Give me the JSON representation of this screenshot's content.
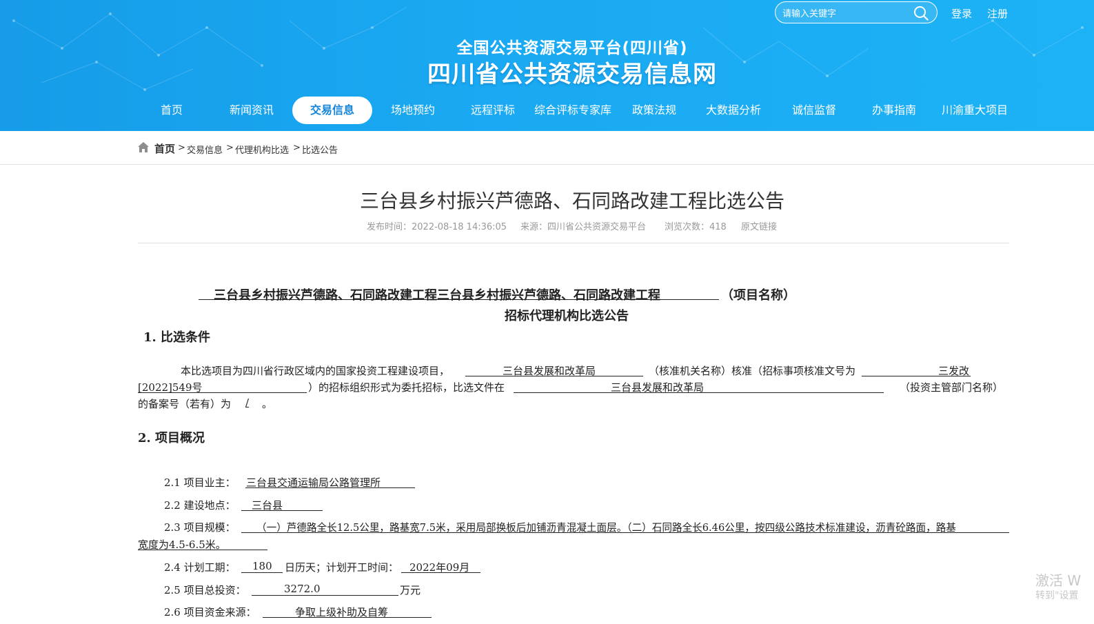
{
  "header": {
    "search_placeholder": "请输入关键字",
    "login": "登录",
    "register": "注册",
    "sub_title": "全国公共资源交易平台(四川省)",
    "main_title": "四川省公共资源交易信息网",
    "nav": [
      "首页",
      "新闻资讯",
      "交易信息",
      "场地预约",
      "远程评标",
      "综合评标专家库",
      "政策法规",
      "大数据分析",
      "诚信监督",
      "办事指南",
      "川渝重大项目"
    ],
    "active_nav": "交易信息"
  },
  "breadcrumb": {
    "home": "首页",
    "items": [
      "交易信息",
      "代理机构比选",
      "比选公告"
    ],
    "separator": ">"
  },
  "article": {
    "title": "三台县乡村振兴芦德路、石同路改建工程比选公告",
    "meta": {
      "publish_time": "发布时间：2022-08-18 14:36:05",
      "source": "来源：四川省公共资源交易平台",
      "views": "浏览次数：418",
      "original_link": "原文链接"
    }
  },
  "doc": {
    "heading_name": "三台县乡村振兴芦德路、石同路改建工程三台县乡村振兴芦德路、石同路改建工程",
    "heading_suffix": "（项目名称）",
    "heading_line2": "招标代理机构比选公告",
    "sec1_title": "1.  比选条件",
    "p1_a": "本比选项目为四川省行政区域内的国家投资工程建设项目，",
    "p1_agency": "三台县发展和改革局",
    "p1_b": "（核准机关名称）核准（招标事项核准文号为",
    "p1_docno_a": "三发改",
    "p1_docno_b": "[2022]549号",
    "p1_c": "）的招标组织形式为委托招标，比选文件在",
    "p1_dept": "三台县发展和改革局",
    "p1_d": "（投资主管部门名称）",
    "p1_e": "的备案号（若有）为",
    "p1_record": "/",
    "p1_end": "。",
    "sec2_title": "2.  项目概况",
    "i21_label": "2.1 项目业主：",
    "i21_value": "三台县交通运输局公路管理所",
    "i22_label": "2.2 建设地点：",
    "i22_value": "三台县",
    "i23_label": "2.3 项目规模：",
    "i23_value_a": "（一）芦德路全长12.5公里，路基宽7.5米，采用局部换板后加铺沥青混凝土面层。（二）石同路全长6.46公里，按四级公路技术标准建设，沥青砼路面，路基",
    "i23_value_b": "宽度为4.5-6.5米。",
    "i24_label": "2.4 计划工期：",
    "i24_days": "180",
    "i24_mid": "日历天；计划开工时间：",
    "i24_start": "2022年09月",
    "i25_label": "2.5 项目总投资：",
    "i25_value": "3272.0",
    "i25_unit": "万元",
    "i26_label": "2.6 项目资金来源：",
    "i26_value": "争取上级补助及自筹"
  },
  "watermark": {
    "line1": "激活 W",
    "line2": "转到\"设置"
  }
}
